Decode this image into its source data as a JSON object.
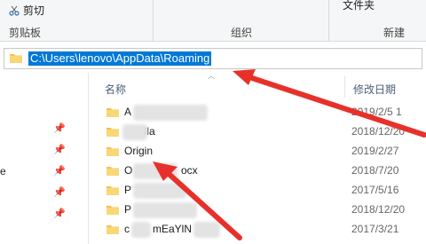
{
  "ribbon": {
    "cut_label": "剪切",
    "clipboard_group": "剪贴板",
    "organize_group": "组织",
    "new_folder_label": "文件夹",
    "new_group": "新建"
  },
  "address": {
    "path": "C:\\Users\\lenovo\\AppData\\Roaming"
  },
  "columns": {
    "name": "名称",
    "modified": "修改日期"
  },
  "nav": {
    "partial_label": "e"
  },
  "files": [
    {
      "name": "A",
      "date": "2019/2/5 1"
    },
    {
      "name": "z..Zilla",
      "date": "2018/12/20"
    },
    {
      "name": "Origin",
      "date": "2019/2/27"
    },
    {
      "name": "O",
      "date": "2018/7/20"
    },
    {
      "name": "P",
      "date": "2017/5/16"
    },
    {
      "name": "P",
      "date": "2018/12/20"
    },
    {
      "name": "c",
      "date": "2017/3/21"
    }
  ],
  "partial_name_suffixes": {
    "row0": "",
    "row3": "ocx",
    "row6": "mEaYlN"
  },
  "colors": {
    "selection": "#0078d7",
    "arrow": "#e8302a",
    "folder": "#f6c14b"
  }
}
